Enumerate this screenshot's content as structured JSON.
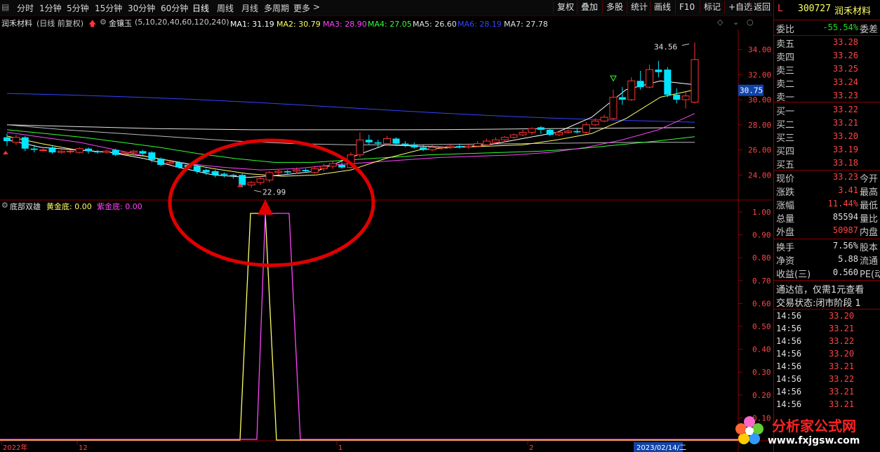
{
  "toolbar": {
    "periods": [
      "分时",
      "1分钟",
      "5分钟",
      "15分钟",
      "30分钟",
      "60分钟",
      "日线",
      "周线",
      "月线",
      "多周期",
      "更多"
    ],
    "active_period": "日线",
    "buttons": [
      "复权",
      "叠加",
      "多股",
      "统计",
      "画线",
      "F10",
      "标记",
      "+自选",
      "返回"
    ]
  },
  "header": {
    "stock_name": "润禾材料",
    "mode": "(日线 前复权)",
    "indicator": "金镶玉",
    "params": "(5,10,20,40,60,120,240)",
    "ma": [
      {
        "label": "MA1: 31.19",
        "color": "#ffffff"
      },
      {
        "label": "MA2: 30.79",
        "color": "#ffff66"
      },
      {
        "label": "MA3: 28.90",
        "color": "#ff44ff"
      },
      {
        "label": "MA4: 27.05",
        "color": "#33ff33"
      },
      {
        "label": "MA5: 26.60",
        "color": "#e0e0e0"
      },
      {
        "label": "MA6: 28.19",
        "color": "#3344ff"
      },
      {
        "label": "MA7: 27.78",
        "color": "#e0e0e0"
      }
    ]
  },
  "main_chart": {
    "price_axis": [
      34.0,
      32.0,
      30.0,
      28.0,
      26.0,
      24.0
    ],
    "current_price_tag": "30.75",
    "high_label": "34.56",
    "low_label": "22.99",
    "colors": {
      "up": "#ff3333",
      "down": "#00e5ff",
      "highlight": "#e00000"
    }
  },
  "sub_chart": {
    "title": "底部双雄",
    "gold_label": "黄金底: 0.00",
    "purple_label": "紫金底: 0.00",
    "axis": [
      "1.00",
      "0.90",
      "0.80",
      "0.70",
      "0.60",
      "0.50",
      "0.40",
      "0.30",
      "0.20",
      "0.10"
    ]
  },
  "x_axis": [
    "2022年",
    "12",
    "1",
    "2",
    "2023/02/14/二"
  ],
  "panel": {
    "code": "300727",
    "name": "润禾材料",
    "prefix": "L",
    "weibi_label": "委比",
    "weibi_value": "-55.54%",
    "weibi_ext": "委差",
    "asks": [
      {
        "label": "卖五",
        "price": "33.28"
      },
      {
        "label": "卖四",
        "price": "33.26"
      },
      {
        "label": "卖三",
        "price": "33.25"
      },
      {
        "label": "卖二",
        "price": "33.24"
      },
      {
        "label": "卖一",
        "price": "33.23"
      }
    ],
    "bids": [
      {
        "label": "买一",
        "price": "33.22"
      },
      {
        "label": "买二",
        "price": "33.21"
      },
      {
        "label": "买三",
        "price": "33.20"
      },
      {
        "label": "买四",
        "price": "33.19"
      },
      {
        "label": "买五",
        "price": "33.18"
      }
    ],
    "quote": [
      {
        "label": "现价",
        "value": "33.23",
        "ext": "今开",
        "cls": "red"
      },
      {
        "label": "涨跌",
        "value": "3.41",
        "ext": "最高",
        "cls": "red"
      },
      {
        "label": "涨幅",
        "value": "11.44%",
        "ext": "最低",
        "cls": "red"
      },
      {
        "label": "总量",
        "value": "85594",
        "ext": "量比",
        "cls": "wh"
      },
      {
        "label": "外盘",
        "value": "50987",
        "ext": "内盘",
        "cls": "red"
      }
    ],
    "stats": [
      {
        "label": "换手",
        "value": "7.56%",
        "ext": "股本"
      },
      {
        "label": "净资",
        "value": "5.88",
        "ext": "流通"
      },
      {
        "label": "收益(三)",
        "value": "0.560",
        "ext": "PE(动"
      }
    ],
    "notice": "通达信，仅需1元查看",
    "trade_status": "交易状态:闭市阶段 1",
    "ticks": [
      {
        "time": "14:56",
        "price": "33.20"
      },
      {
        "time": "14:56",
        "price": "33.21"
      },
      {
        "time": "14:56",
        "price": "33.22"
      },
      {
        "time": "14:56",
        "price": "33.20"
      },
      {
        "time": "14:56",
        "price": "33.21"
      },
      {
        "time": "14:56",
        "price": "33.22"
      },
      {
        "time": "14:56",
        "price": "33.21"
      },
      {
        "time": "14:56",
        "price": "33.21"
      }
    ]
  },
  "watermark": {
    "title": "分析家公式网",
    "url": "www.fxjgsw.com"
  }
}
